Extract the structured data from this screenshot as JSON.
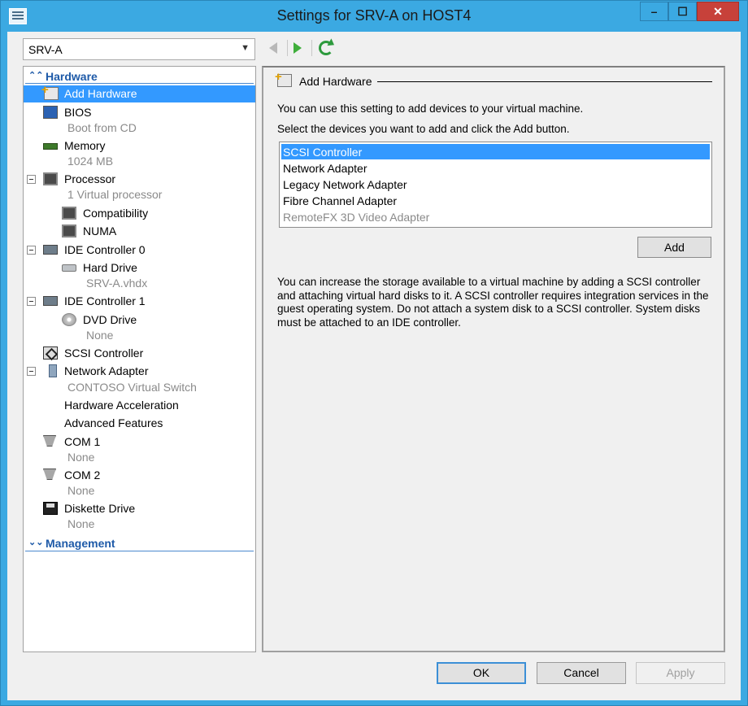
{
  "window": {
    "title": "Settings for SRV-A on HOST4"
  },
  "vm_selector": {
    "value": "SRV-A"
  },
  "tree": {
    "hardware_section": "Hardware",
    "management_section": "Management",
    "items": [
      {
        "label": "Add Hardware"
      },
      {
        "label": "BIOS"
      },
      {
        "label": "Boot from CD"
      },
      {
        "label": "Memory"
      },
      {
        "label": "1024 MB"
      },
      {
        "label": "Processor"
      },
      {
        "label": "1 Virtual processor"
      },
      {
        "label": "Compatibility"
      },
      {
        "label": "NUMA"
      },
      {
        "label": "IDE Controller 0"
      },
      {
        "label": "Hard Drive"
      },
      {
        "label": "SRV-A.vhdx"
      },
      {
        "label": "IDE Controller 1"
      },
      {
        "label": "DVD Drive"
      },
      {
        "label": "None"
      },
      {
        "label": "SCSI Controller"
      },
      {
        "label": "Network Adapter"
      },
      {
        "label": "CONTOSO Virtual Switch"
      },
      {
        "label": "Hardware Acceleration"
      },
      {
        "label": "Advanced Features"
      },
      {
        "label": "COM 1"
      },
      {
        "label": "None"
      },
      {
        "label": "COM 2"
      },
      {
        "label": "None"
      },
      {
        "label": "Diskette Drive"
      },
      {
        "label": "None"
      }
    ]
  },
  "panel": {
    "title": "Add Hardware",
    "intro": "You can use this setting to add devices to your virtual machine.",
    "instruction": "Select the devices you want to add and click the Add button.",
    "devices": [
      "SCSI Controller",
      "Network Adapter",
      "Legacy Network Adapter",
      "Fibre Channel Adapter",
      "RemoteFX 3D Video Adapter"
    ],
    "add_label": "Add",
    "description": "You can increase the storage available to a virtual machine by adding a SCSI controller and attaching virtual hard disks to it. A SCSI controller requires integration services in the guest operating system. Do not attach a system disk to a SCSI controller. System disks must be attached to an IDE controller."
  },
  "buttons": {
    "ok": "OK",
    "cancel": "Cancel",
    "apply": "Apply"
  }
}
